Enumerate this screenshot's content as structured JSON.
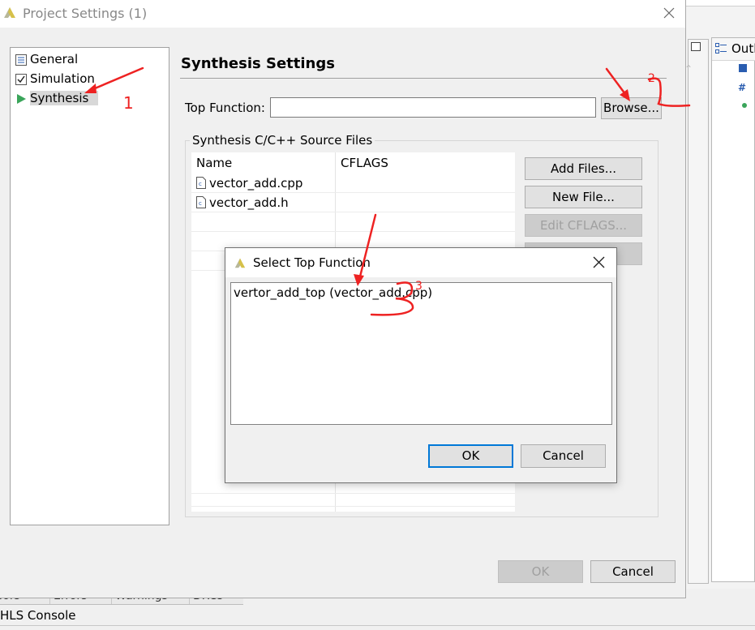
{
  "dialog": {
    "title": "Project Settings (1)",
    "nav": [
      {
        "label": "General",
        "icon": "settings-icon"
      },
      {
        "label": "Simulation",
        "icon": "checkbox-icon"
      },
      {
        "label": "Synthesis",
        "icon": "play-icon",
        "selected": true
      }
    ],
    "section_title": "Synthesis Settings",
    "top_function_label": "Top Function:",
    "top_function_value": "",
    "browse_label": "Browse...",
    "group_title": "Synthesis C/C++ Source Files",
    "table": {
      "columns": [
        "Name",
        "CFLAGS"
      ],
      "rows": [
        {
          "name": "vector_add.cpp",
          "cflags": ""
        },
        {
          "name": "vector_add.h",
          "cflags": ""
        }
      ]
    },
    "buttons": {
      "add_files": "Add Files...",
      "new_file": "New File...",
      "edit_cflags": "Edit CFLAGS...",
      "ok": "OK",
      "cancel": "Cancel"
    }
  },
  "sub_dialog": {
    "title": "Select Top Function",
    "items": [
      "vertor_add_top (vector_add.cpp)"
    ],
    "ok": "OK",
    "cancel": "Cancel"
  },
  "background": {
    "outline_label": "Outl",
    "bottom_tabs": [
      "sole",
      "Errors",
      "Warnings",
      "DRCs"
    ],
    "console_label": "HLS Console"
  },
  "annotations": [
    "1",
    "2",
    "3"
  ],
  "colors": {
    "annotation": "#ee2222",
    "selection": "#d8d8d8",
    "focus_border": "#0078d7",
    "disabled_text": "#a0a0a0"
  }
}
